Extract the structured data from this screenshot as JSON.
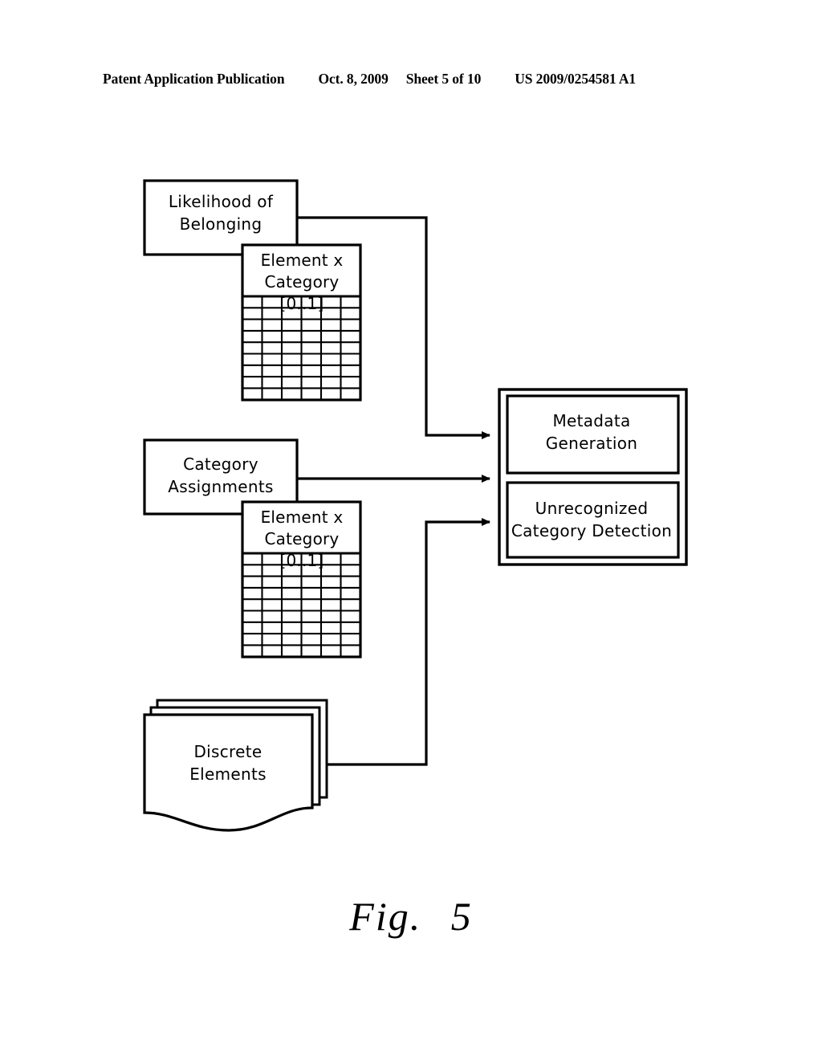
{
  "header": {
    "publication": "Patent Application Publication",
    "date": "Oct. 8, 2009",
    "sheet": "Sheet 5 of 10",
    "patent_number": "US 2009/0254581 A1"
  },
  "figure": {
    "caption_word": "Fig.",
    "caption_number": "5",
    "nodes": {
      "likelihood_of_belonging": "Likelihood  of\nBelonging",
      "likelihood_table_title": "Element  x\nCategory  [0..1]",
      "category_assignments": "Category\nAssignments",
      "category_table_title": "Element  x\nCategory  [0..1]",
      "metadata_generation": "Metadata\nGeneration",
      "unrecognized_category_detection": "Unrecognized\nCategory  Detection",
      "discrete_elements": "Discrete\nElements"
    },
    "table_grid": {
      "columns": 6,
      "rows": 9
    },
    "colors": {
      "stroke": "#000000",
      "fill": "#ffffff",
      "background": "#ffffff"
    }
  }
}
